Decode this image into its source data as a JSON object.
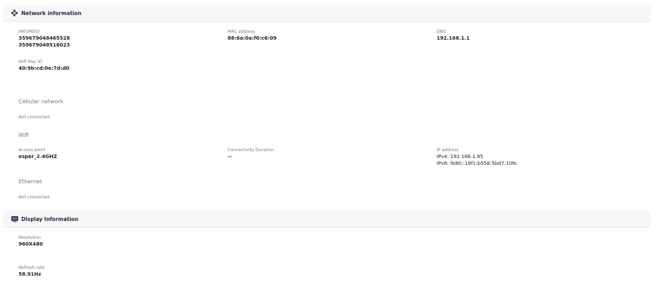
{
  "network": {
    "title": "Network information",
    "icon": "network-icon",
    "imei": {
      "label": "IMEI/MEID",
      "values": [
        "359679048465528",
        "359679048516023"
      ]
    },
    "mac": {
      "label": "MAC address",
      "value": "88:6a:0a:f0:c6:09"
    },
    "dns": {
      "label": "DNS",
      "value": "192.168.1.1"
    },
    "wifi_mac": {
      "label": "Wifi Mac ID",
      "value": "40:9b:cd:0e:7d:d0"
    },
    "cellular": {
      "heading": "Cellular network",
      "status": "Not connected"
    },
    "wifi": {
      "heading": "Wifi",
      "access_point": {
        "label": "Access point",
        "value": "esper_2.4GHZ"
      },
      "duration": {
        "label": "Connectivity Duration",
        "value": "--"
      },
      "ip": {
        "label": "IP address",
        "ipv4": "IPv4: 192.168.1.85",
        "ipv6": "IPv6: fe80::18f1:b558:5bd7:10fe"
      }
    },
    "ethernet": {
      "heading": "Ethernet",
      "status": "Not connected"
    }
  },
  "display": {
    "title": "Display Information",
    "icon": "display-icon",
    "resolution": {
      "label": "Resolution",
      "value": "960X480"
    },
    "refresh_rate": {
      "label": "Refresh rate",
      "value": "58.91Hz"
    }
  }
}
